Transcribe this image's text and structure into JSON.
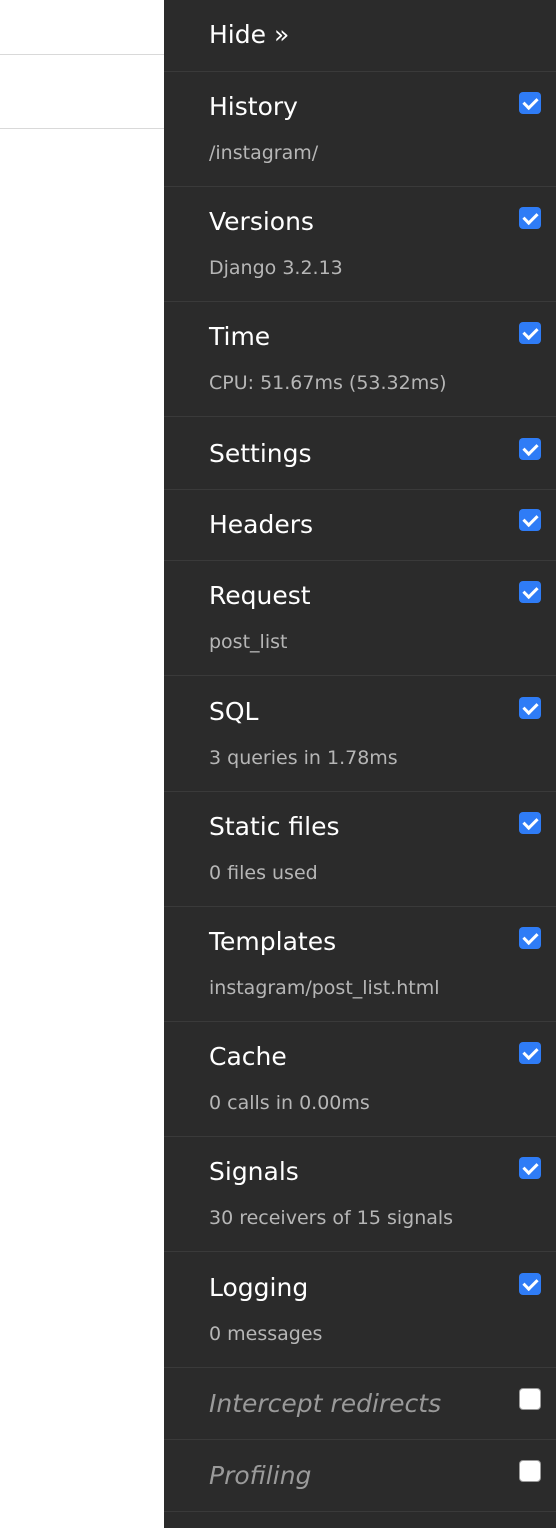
{
  "toolbar": {
    "hide_label": "Hide »",
    "panels": [
      {
        "title": "History",
        "subtitle": "/instagram/",
        "checked": true
      },
      {
        "title": "Versions",
        "subtitle": "Django 3.2.13",
        "checked": true
      },
      {
        "title": "Time",
        "subtitle": "CPU: 51.67ms (53.32ms)",
        "checked": true
      },
      {
        "title": "Settings",
        "subtitle": "",
        "checked": true
      },
      {
        "title": "Headers",
        "subtitle": "",
        "checked": true
      },
      {
        "title": "Request",
        "subtitle": "post_list",
        "checked": true
      },
      {
        "title": "SQL",
        "subtitle": "3 queries in 1.78ms",
        "checked": true
      },
      {
        "title": "Static files",
        "subtitle": "0 files used",
        "checked": true
      },
      {
        "title": "Templates",
        "subtitle": "instagram/post_list.html",
        "checked": true
      },
      {
        "title": "Cache",
        "subtitle": "0 calls in 0.00ms",
        "checked": true
      },
      {
        "title": "Signals",
        "subtitle": "30 receivers of 15 signals",
        "checked": true
      },
      {
        "title": "Logging",
        "subtitle": "0 messages",
        "checked": true
      },
      {
        "title": "Intercept redirects",
        "subtitle": "",
        "checked": false
      },
      {
        "title": "Profiling",
        "subtitle": "",
        "checked": false
      }
    ]
  },
  "colors": {
    "toolbar_bg": "#2b2b2b",
    "checkbox_checked": "#2f7cf6",
    "title_text": "#ffffff",
    "subtitle_text": "#b6b6b6",
    "disabled_text": "#9a9a9a"
  }
}
